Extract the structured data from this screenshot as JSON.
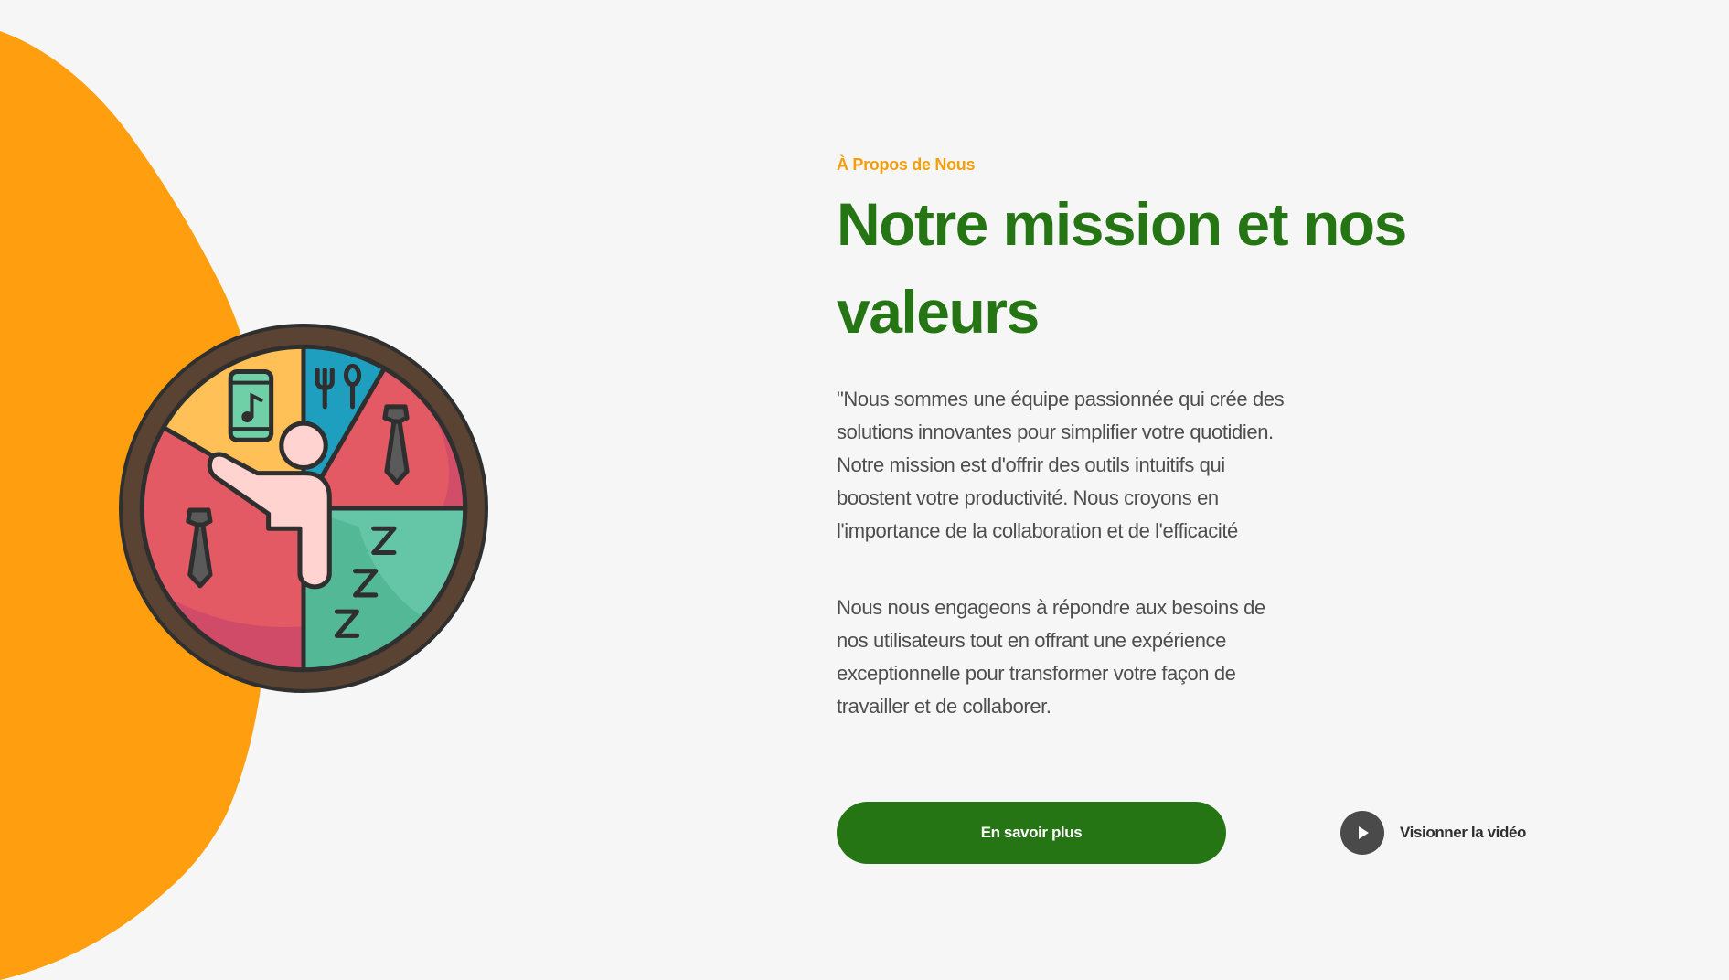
{
  "colors": {
    "background": "#f6f6f6",
    "accent_orange": "#ff9f10",
    "brand_green": "#267515",
    "body_text": "#4e4e4e"
  },
  "about": {
    "eyebrow": "À Propos de Nous",
    "title": "Notre mission et nos valeurs",
    "paragraph_1": "\"Nous sommes une équipe passionnée qui crée des solutions innovantes pour simplifier votre quotidien. Notre mission est d'offrir des outils intuitifs qui boostent votre productivité. Nous croyons en l'importance de la collaboration et de l'efficacité",
    "paragraph_2": "Nous nous engageons à répondre aux besoins de nos utilisateurs tout en offrant une expérience exceptionnelle pour transformer votre façon de travailler et de collaborer."
  },
  "actions": {
    "primary_label": "En savoir plus",
    "video_label": "Visionner la vidéo",
    "video_icon": "play-icon"
  },
  "illustration": {
    "icon": "time-management-wheel-icon"
  }
}
